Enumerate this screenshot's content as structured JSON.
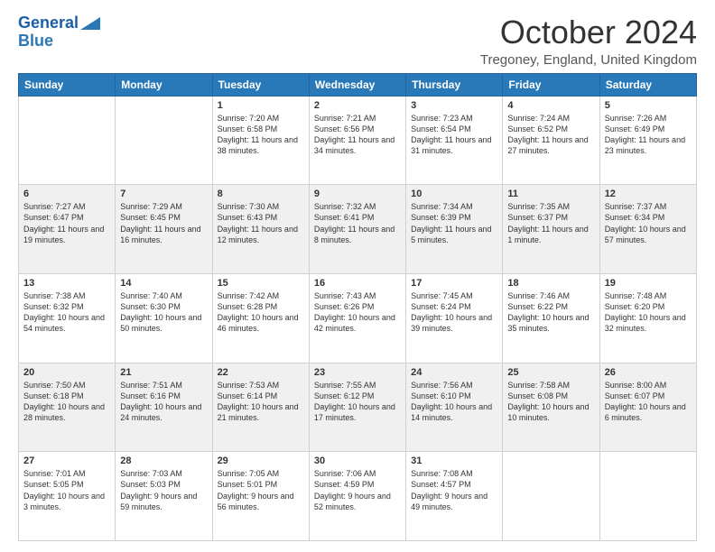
{
  "header": {
    "logo_line1": "General",
    "logo_line2": "Blue",
    "month_title": "October 2024",
    "location": "Tregoney, England, United Kingdom"
  },
  "days_of_week": [
    "Sunday",
    "Monday",
    "Tuesday",
    "Wednesday",
    "Thursday",
    "Friday",
    "Saturday"
  ],
  "weeks": [
    [
      {
        "day": "",
        "info": ""
      },
      {
        "day": "",
        "info": ""
      },
      {
        "day": "1",
        "info": "Sunrise: 7:20 AM\nSunset: 6:58 PM\nDaylight: 11 hours and 38 minutes."
      },
      {
        "day": "2",
        "info": "Sunrise: 7:21 AM\nSunset: 6:56 PM\nDaylight: 11 hours and 34 minutes."
      },
      {
        "day": "3",
        "info": "Sunrise: 7:23 AM\nSunset: 6:54 PM\nDaylight: 11 hours and 31 minutes."
      },
      {
        "day": "4",
        "info": "Sunrise: 7:24 AM\nSunset: 6:52 PM\nDaylight: 11 hours and 27 minutes."
      },
      {
        "day": "5",
        "info": "Sunrise: 7:26 AM\nSunset: 6:49 PM\nDaylight: 11 hours and 23 minutes."
      }
    ],
    [
      {
        "day": "6",
        "info": "Sunrise: 7:27 AM\nSunset: 6:47 PM\nDaylight: 11 hours and 19 minutes."
      },
      {
        "day": "7",
        "info": "Sunrise: 7:29 AM\nSunset: 6:45 PM\nDaylight: 11 hours and 16 minutes."
      },
      {
        "day": "8",
        "info": "Sunrise: 7:30 AM\nSunset: 6:43 PM\nDaylight: 11 hours and 12 minutes."
      },
      {
        "day": "9",
        "info": "Sunrise: 7:32 AM\nSunset: 6:41 PM\nDaylight: 11 hours and 8 minutes."
      },
      {
        "day": "10",
        "info": "Sunrise: 7:34 AM\nSunset: 6:39 PM\nDaylight: 11 hours and 5 minutes."
      },
      {
        "day": "11",
        "info": "Sunrise: 7:35 AM\nSunset: 6:37 PM\nDaylight: 11 hours and 1 minute."
      },
      {
        "day": "12",
        "info": "Sunrise: 7:37 AM\nSunset: 6:34 PM\nDaylight: 10 hours and 57 minutes."
      }
    ],
    [
      {
        "day": "13",
        "info": "Sunrise: 7:38 AM\nSunset: 6:32 PM\nDaylight: 10 hours and 54 minutes."
      },
      {
        "day": "14",
        "info": "Sunrise: 7:40 AM\nSunset: 6:30 PM\nDaylight: 10 hours and 50 minutes."
      },
      {
        "day": "15",
        "info": "Sunrise: 7:42 AM\nSunset: 6:28 PM\nDaylight: 10 hours and 46 minutes."
      },
      {
        "day": "16",
        "info": "Sunrise: 7:43 AM\nSunset: 6:26 PM\nDaylight: 10 hours and 42 minutes."
      },
      {
        "day": "17",
        "info": "Sunrise: 7:45 AM\nSunset: 6:24 PM\nDaylight: 10 hours and 39 minutes."
      },
      {
        "day": "18",
        "info": "Sunrise: 7:46 AM\nSunset: 6:22 PM\nDaylight: 10 hours and 35 minutes."
      },
      {
        "day": "19",
        "info": "Sunrise: 7:48 AM\nSunset: 6:20 PM\nDaylight: 10 hours and 32 minutes."
      }
    ],
    [
      {
        "day": "20",
        "info": "Sunrise: 7:50 AM\nSunset: 6:18 PM\nDaylight: 10 hours and 28 minutes."
      },
      {
        "day": "21",
        "info": "Sunrise: 7:51 AM\nSunset: 6:16 PM\nDaylight: 10 hours and 24 minutes."
      },
      {
        "day": "22",
        "info": "Sunrise: 7:53 AM\nSunset: 6:14 PM\nDaylight: 10 hours and 21 minutes."
      },
      {
        "day": "23",
        "info": "Sunrise: 7:55 AM\nSunset: 6:12 PM\nDaylight: 10 hours and 17 minutes."
      },
      {
        "day": "24",
        "info": "Sunrise: 7:56 AM\nSunset: 6:10 PM\nDaylight: 10 hours and 14 minutes."
      },
      {
        "day": "25",
        "info": "Sunrise: 7:58 AM\nSunset: 6:08 PM\nDaylight: 10 hours and 10 minutes."
      },
      {
        "day": "26",
        "info": "Sunrise: 8:00 AM\nSunset: 6:07 PM\nDaylight: 10 hours and 6 minutes."
      }
    ],
    [
      {
        "day": "27",
        "info": "Sunrise: 7:01 AM\nSunset: 5:05 PM\nDaylight: 10 hours and 3 minutes."
      },
      {
        "day": "28",
        "info": "Sunrise: 7:03 AM\nSunset: 5:03 PM\nDaylight: 9 hours and 59 minutes."
      },
      {
        "day": "29",
        "info": "Sunrise: 7:05 AM\nSunset: 5:01 PM\nDaylight: 9 hours and 56 minutes."
      },
      {
        "day": "30",
        "info": "Sunrise: 7:06 AM\nSunset: 4:59 PM\nDaylight: 9 hours and 52 minutes."
      },
      {
        "day": "31",
        "info": "Sunrise: 7:08 AM\nSunset: 4:57 PM\nDaylight: 9 hours and 49 minutes."
      },
      {
        "day": "",
        "info": ""
      },
      {
        "day": "",
        "info": ""
      }
    ]
  ]
}
